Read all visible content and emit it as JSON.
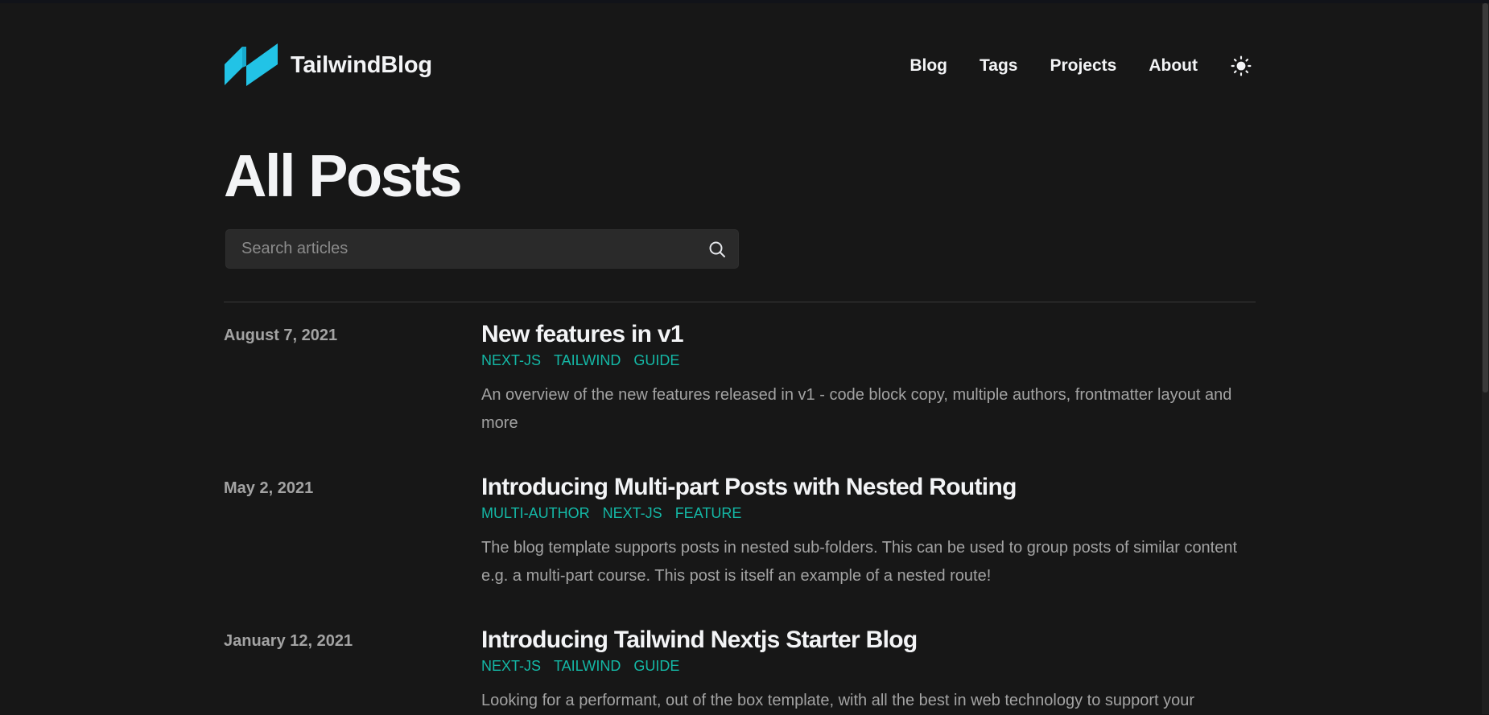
{
  "header": {
    "brand": "TailwindBlog",
    "nav": [
      "Blog",
      "Tags",
      "Projects",
      "About"
    ]
  },
  "page": {
    "title": "All Posts"
  },
  "search": {
    "placeholder": "Search articles"
  },
  "colors": {
    "background": "#171717",
    "accent": "#14b8a6",
    "logo": "#22c3e6"
  },
  "icons": [
    "logo-icon",
    "sun-icon",
    "search-icon"
  ],
  "posts": [
    {
      "date": "August 7, 2021",
      "title": "New features in v1",
      "tags": [
        "NEXT-JS",
        "TAILWIND",
        "GUIDE"
      ],
      "summary": "An overview of the new features released in v1 - code block copy, multiple authors, frontmatter layout and more"
    },
    {
      "date": "May 2, 2021",
      "title": "Introducing Multi-part Posts with Nested Routing",
      "tags": [
        "MULTI-AUTHOR",
        "NEXT-JS",
        "FEATURE"
      ],
      "summary": "The blog template supports posts in nested sub-folders. This can be used to group posts of similar content e.g. a multi-part course. This post is itself an example of a nested route!"
    },
    {
      "date": "January 12, 2021",
      "title": "Introducing Tailwind Nextjs Starter Blog",
      "tags": [
        "NEXT-JS",
        "TAILWIND",
        "GUIDE"
      ],
      "summary": "Looking for a performant, out of the box template, with all the best in web technology to support your"
    }
  ]
}
